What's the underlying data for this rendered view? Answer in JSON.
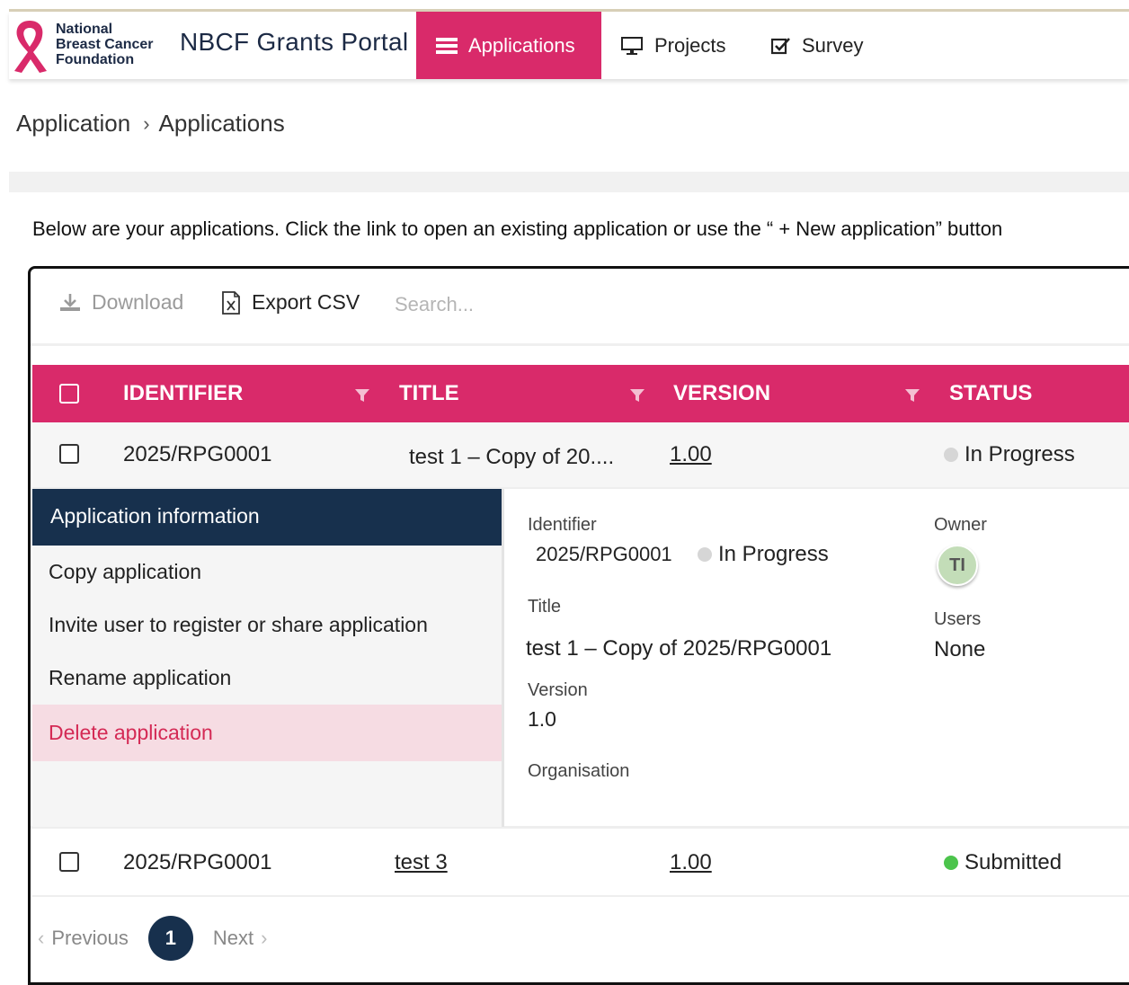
{
  "brand": {
    "logo_lines": [
      "National",
      "Breast Cancer",
      "Foundation"
    ],
    "portal_title": "NBCF Grants Portal",
    "accent_color": "#d92a6a",
    "navy_color": "#17304d"
  },
  "nav": {
    "applications": "Applications",
    "projects": "Projects",
    "survey": "Survey"
  },
  "breadcrumb": {
    "root": "Application",
    "separator": "›",
    "current": "Applications"
  },
  "intro_text": "Below are your applications. Click the link to open an existing application or use the “ + New application” button",
  "toolbar": {
    "download": "Download",
    "export_csv": "Export CSV",
    "search_placeholder": "Search..."
  },
  "table": {
    "columns": [
      "IDENTIFIER",
      "TITLE",
      "VERSION",
      "STATUS"
    ],
    "rows": [
      {
        "identifier": "2025/RPG0001",
        "title": "test 1 – Copy of 20....",
        "version": "1.00",
        "status": "In Progress",
        "status_color": "#d6d6d6"
      },
      {
        "identifier": "2025/RPG0001",
        "title": "test 3",
        "version": "1.00",
        "status": "Submitted",
        "status_color": "#4cc44c"
      }
    ]
  },
  "detail": {
    "menu_title": "Application information",
    "menu_items": [
      "Copy application",
      "Invite user to register or share application",
      "Rename application",
      "Delete application"
    ],
    "labels": {
      "identifier": "Identifier",
      "owner": "Owner",
      "title": "Title",
      "users": "Users",
      "version": "Version",
      "organisation": "Organisation"
    },
    "values": {
      "identifier": "2025/RPG0001",
      "status": "In Progress",
      "owner_initials": "TI",
      "title": "test 1 – Copy of 2025/RPG0001",
      "users": "None",
      "version": "1.0"
    }
  },
  "pager": {
    "previous": "Previous",
    "page": "1",
    "next": "Next"
  }
}
